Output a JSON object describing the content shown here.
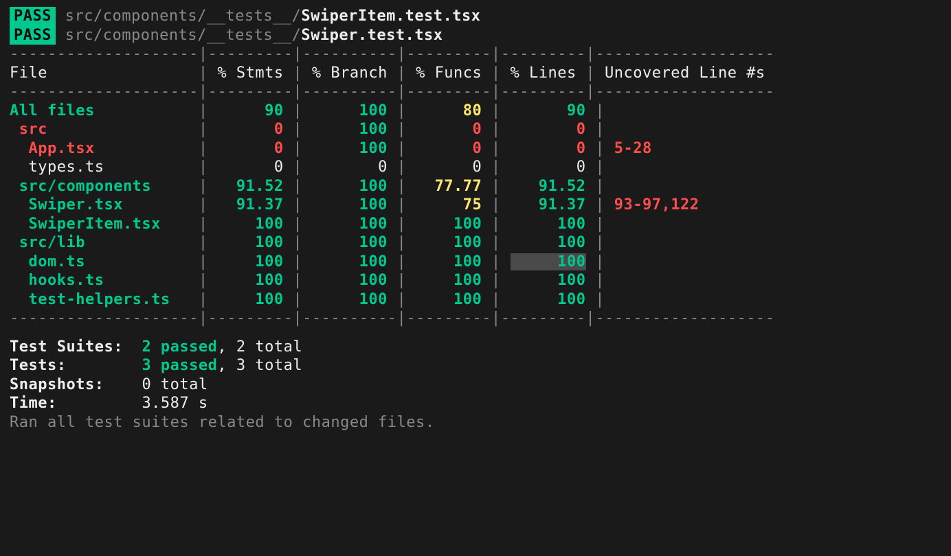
{
  "tests": [
    {
      "status": "PASS",
      "path": "src/components/__tests__/",
      "file": "SwiperItem.test.tsx"
    },
    {
      "status": "PASS",
      "path": "src/components/__tests__/",
      "file": "Swiper.test.tsx"
    }
  ],
  "header": {
    "file": "File",
    "stmts": "% Stmts",
    "branch": "% Branch",
    "funcs": "% Funcs",
    "lines": "% Lines",
    "uncovered": "Uncovered Line #s"
  },
  "rows": [
    {
      "file": "All files",
      "indent": 0,
      "fileColor": "green bold",
      "stmts": "90",
      "stmtsColor": "green bold",
      "branch": "100",
      "branchColor": "green bold",
      "funcs": "80",
      "funcsColor": "yellow bold",
      "lines": "90",
      "linesColor": "green bold",
      "uncovered": "",
      "uncoveredColor": ""
    },
    {
      "file": "src",
      "indent": 1,
      "fileColor": "red bold",
      "stmts": "0",
      "stmtsColor": "red bold",
      "branch": "100",
      "branchColor": "green bold",
      "funcs": "0",
      "funcsColor": "red bold",
      "lines": "0",
      "linesColor": "red bold",
      "uncovered": "",
      "uncoveredColor": ""
    },
    {
      "file": "App.tsx",
      "indent": 2,
      "fileColor": "red bold",
      "stmts": "0",
      "stmtsColor": "red bold",
      "branch": "100",
      "branchColor": "green bold",
      "funcs": "0",
      "funcsColor": "red bold",
      "lines": "0",
      "linesColor": "red bold",
      "uncovered": "5-28",
      "uncoveredColor": "red bold"
    },
    {
      "file": "types.ts",
      "indent": 2,
      "fileColor": "white",
      "stmts": "0",
      "stmtsColor": "white",
      "branch": "0",
      "branchColor": "white",
      "funcs": "0",
      "funcsColor": "white",
      "lines": "0",
      "linesColor": "white",
      "uncovered": "",
      "uncoveredColor": ""
    },
    {
      "file": "src/components",
      "indent": 1,
      "fileColor": "green bold",
      "stmts": "91.52",
      "stmtsColor": "green bold",
      "branch": "100",
      "branchColor": "green bold",
      "funcs": "77.77",
      "funcsColor": "yellow bold",
      "lines": "91.52",
      "linesColor": "green bold",
      "uncovered": "",
      "uncoveredColor": ""
    },
    {
      "file": "Swiper.tsx",
      "indent": 2,
      "fileColor": "green bold",
      "stmts": "91.37",
      "stmtsColor": "green bold",
      "branch": "100",
      "branchColor": "green bold",
      "funcs": "75",
      "funcsColor": "yellow bold",
      "lines": "91.37",
      "linesColor": "green bold",
      "uncovered": "93-97,122",
      "uncoveredColor": "red bold"
    },
    {
      "file": "SwiperItem.tsx",
      "indent": 2,
      "fileColor": "green bold",
      "stmts": "100",
      "stmtsColor": "green bold",
      "branch": "100",
      "branchColor": "green bold",
      "funcs": "100",
      "funcsColor": "green bold",
      "lines": "100",
      "linesColor": "green bold",
      "uncovered": "",
      "uncoveredColor": ""
    },
    {
      "file": "src/lib",
      "indent": 1,
      "fileColor": "green bold",
      "stmts": "100",
      "stmtsColor": "green bold",
      "branch": "100",
      "branchColor": "green bold",
      "funcs": "100",
      "funcsColor": "green bold",
      "lines": "100",
      "linesColor": "green bold",
      "uncovered": "",
      "uncoveredColor": ""
    },
    {
      "file": "dom.ts",
      "indent": 2,
      "fileColor": "green bold",
      "stmts": "100",
      "stmtsColor": "green bold",
      "branch": "100",
      "branchColor": "green bold",
      "funcs": "100",
      "funcsColor": "green bold",
      "lines": "100",
      "linesColor": "green bold highlighted",
      "uncovered": "",
      "uncoveredColor": ""
    },
    {
      "file": "hooks.ts",
      "indent": 2,
      "fileColor": "green bold",
      "stmts": "100",
      "stmtsColor": "green bold",
      "branch": "100",
      "branchColor": "green bold",
      "funcs": "100",
      "funcsColor": "green bold",
      "lines": "100",
      "linesColor": "green bold",
      "uncovered": "",
      "uncoveredColor": ""
    },
    {
      "file": "test-helpers.ts",
      "indent": 2,
      "fileColor": "green bold",
      "stmts": "100",
      "stmtsColor": "green bold",
      "branch": "100",
      "branchColor": "green bold",
      "funcs": "100",
      "funcsColor": "green bold",
      "lines": "100",
      "linesColor": "green bold",
      "uncovered": "",
      "uncoveredColor": ""
    }
  ],
  "summary": {
    "suites_label": "Test Suites:",
    "suites_passed": "2 passed",
    "suites_total": ", 2 total",
    "tests_label": "Tests:",
    "tests_passed": "3 passed",
    "tests_total": ", 3 total",
    "snapshots_label": "Snapshots:",
    "snapshots_value": "0 total",
    "time_label": "Time:",
    "time_value": "3.587 s",
    "footer": "Ran all test suites related to changed files."
  },
  "widths": {
    "file": 20,
    "stmts": 9,
    "branch": 10,
    "funcs": 9,
    "lines": 9,
    "uncovered": 19
  }
}
